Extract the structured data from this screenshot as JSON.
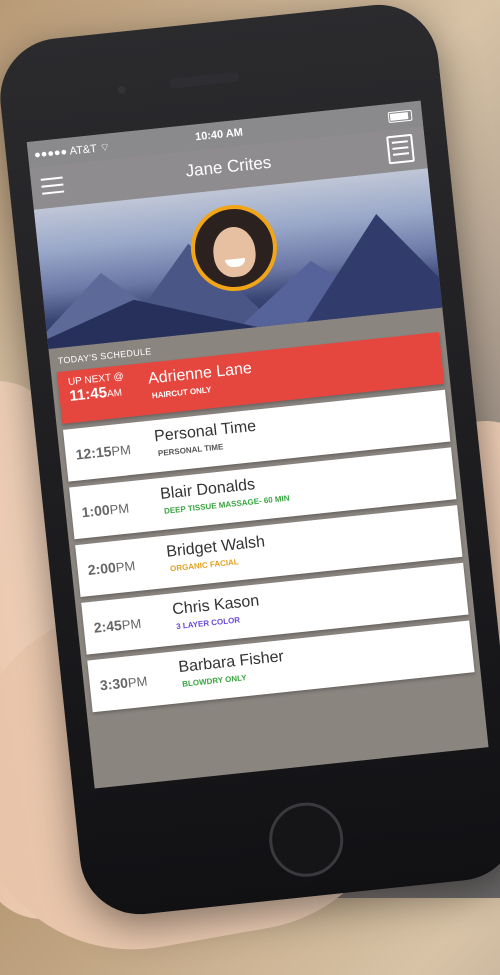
{
  "status": {
    "carrier": "●●●●● AT&T ⌔",
    "time": "10:40 AM"
  },
  "header": {
    "title": "Jane Crites"
  },
  "schedule": {
    "label": "TODAY'S SCHEDULE",
    "appointments": [
      {
        "prefix": "UP NEXT @",
        "time": "11:45",
        "ampm": "AM",
        "name": "Adrienne Lane",
        "service": "HAIRCUT ONLY",
        "service_color": "#ffffff",
        "next": true
      },
      {
        "time": "12:15",
        "ampm": "PM",
        "name": "Personal Time",
        "service": "PERSONAL TIME",
        "service_color": "#555555"
      },
      {
        "time": "1:00",
        "ampm": "PM",
        "name": "Blair Donalds",
        "service": "DEEP TISSUE MASSAGE- 60 MIN",
        "service_color": "#3aa542"
      },
      {
        "time": "2:00",
        "ampm": "PM",
        "name": "Bridget Walsh",
        "service": "ORGANIC FACIAL",
        "service_color": "#e0a322"
      },
      {
        "time": "2:45",
        "ampm": "PM",
        "name": "Chris Kason",
        "service": "3 LAYER COLOR",
        "service_color": "#6b4bd6"
      },
      {
        "time": "3:30",
        "ampm": "PM",
        "name": "Barbara Fisher",
        "service": "BLOWDRY ONLY",
        "service_color": "#3aa542"
      }
    ]
  }
}
